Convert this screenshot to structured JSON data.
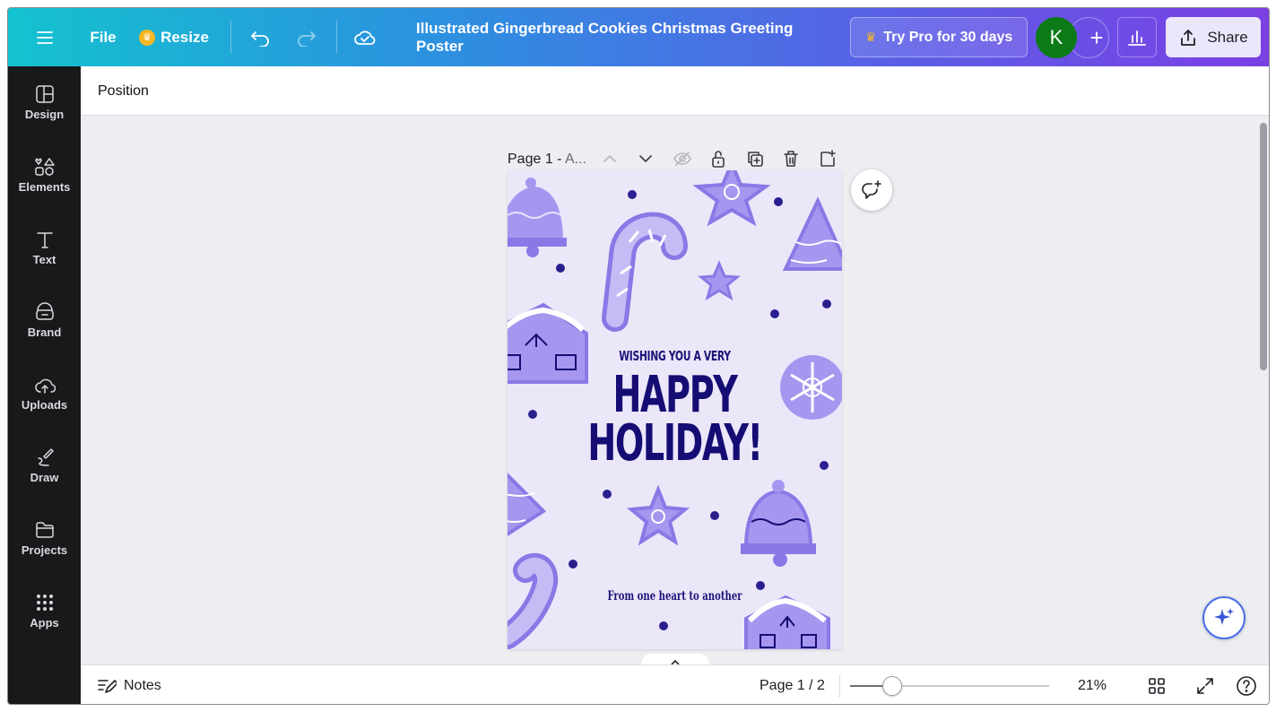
{
  "topbar": {
    "menu_icon": "hamburger-icon",
    "file_label": "File",
    "resize_label": "Resize",
    "title": "Illustrated Gingerbread Cookies Christmas Greeting Poster",
    "try_pro_label": "Try Pro for 30 days",
    "avatar_letter": "K",
    "add_label": "+",
    "share_label": "Share",
    "colors": {
      "gradient_start": "#14c2cf",
      "gradient_end": "#7b3fe4",
      "avatar": "#0c7a16",
      "crown": "#f7b824"
    }
  },
  "sidebar": {
    "items": [
      {
        "label": "Design",
        "icon": "layout-icon"
      },
      {
        "label": "Elements",
        "icon": "shapes-icon"
      },
      {
        "label": "Text",
        "icon": "text-icon"
      },
      {
        "label": "Brand",
        "icon": "brand-icon"
      },
      {
        "label": "Uploads",
        "icon": "cloud-upload-icon"
      },
      {
        "label": "Draw",
        "icon": "pen-icon"
      },
      {
        "label": "Projects",
        "icon": "folder-icon"
      },
      {
        "label": "Apps",
        "icon": "apps-grid-icon"
      }
    ]
  },
  "context_toolbar": {
    "position_label": "Position"
  },
  "page_header": {
    "label_main": "Page 1 -",
    "label_dim": "A..."
  },
  "poster": {
    "pre_heading": "WISHING YOU A VERY",
    "heading_line1": "HAPPY",
    "heading_line2": "HOLIDAY!",
    "footer": "From one heart to another",
    "colors": {
      "background": "#ebe7f9",
      "text": "#150d74",
      "cookie": "#a796ef",
      "dot": "#2a1f8f"
    }
  },
  "bottombar": {
    "notes_label": "Notes",
    "page_indicator": "Page 1 / 2",
    "zoom_fraction": 0.21,
    "zoom_label": "21%"
  }
}
